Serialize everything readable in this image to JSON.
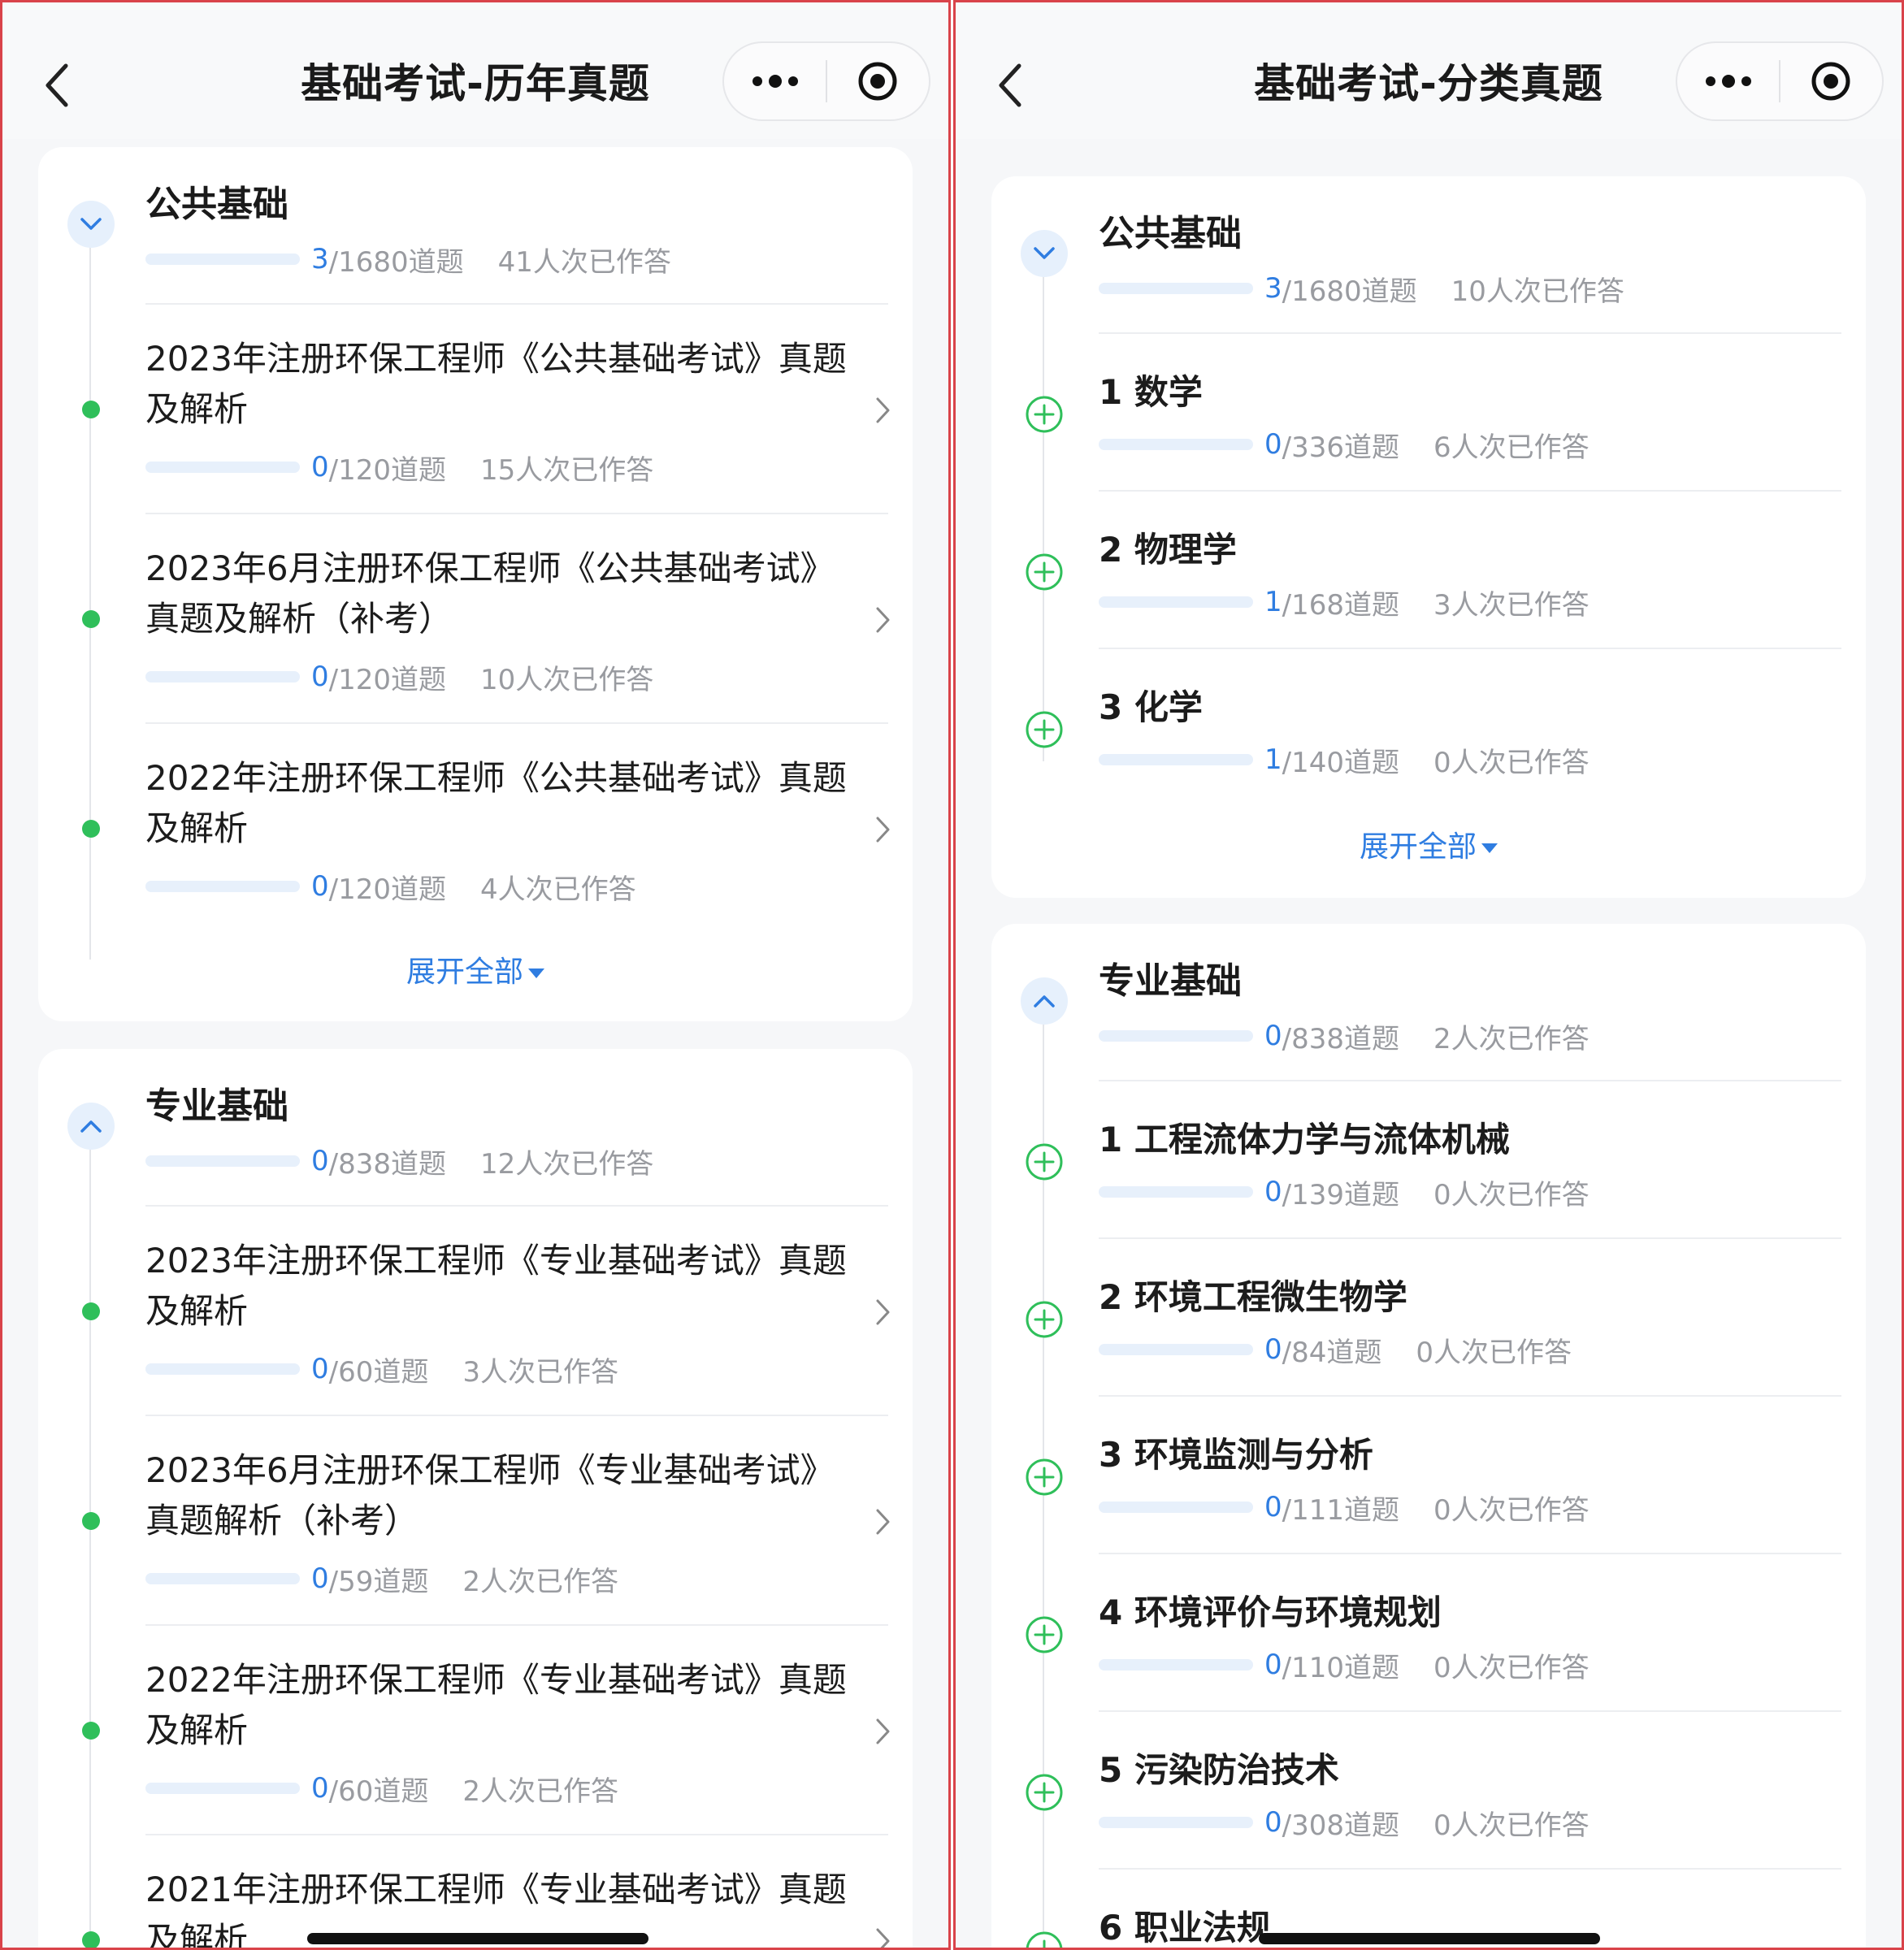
{
  "left": {
    "title": "基础考试-历年真题",
    "groups": [
      {
        "title": "公共基础",
        "done": "3",
        "total": "/1680道题",
        "answered": "41人次已作答",
        "items": [
          {
            "line1": "2023年注册环保工程师《公共基础考试》真题",
            "line2": "及解析",
            "done": "0",
            "total": "/120道题",
            "answered": "15人次已作答"
          },
          {
            "line1": "2023年6月注册环保工程师《公共基础考试》",
            "line2": "真题及解析（补考）",
            "done": "0",
            "total": "/120道题",
            "answered": "10人次已作答"
          },
          {
            "line1": "2022年注册环保工程师《公共基础考试》真题",
            "line2": "及解析",
            "done": "0",
            "total": "/120道题",
            "answered": "4人次已作答"
          }
        ],
        "expand_label": "展开全部"
      },
      {
        "title": "专业基础",
        "done": "0",
        "total": "/838道题",
        "answered": "12人次已作答",
        "items": [
          {
            "line1": "2023年注册环保工程师《专业基础考试》真题",
            "line2": "及解析",
            "done": "0",
            "total": "/60道题",
            "answered": "3人次已作答"
          },
          {
            "line1": "2023年6月注册环保工程师《专业基础考试》",
            "line2": "真题解析（补考）",
            "done": "0",
            "total": "/59道题",
            "answered": "2人次已作答"
          },
          {
            "line1": "2022年注册环保工程师《专业基础考试》真题",
            "line2": "及解析",
            "done": "0",
            "total": "/60道题",
            "answered": "2人次已作答"
          },
          {
            "line1": "2021年注册环保工程师《专业基础考试》真题",
            "line2": "及解析"
          }
        ]
      }
    ]
  },
  "right": {
    "title": "基础考试-分类真题",
    "groups": [
      {
        "title": "公共基础",
        "done": "3",
        "total": "/1680道题",
        "answered": "10人次已作答",
        "items": [
          {
            "title": "1 数学",
            "done": "0",
            "total": "/336道题",
            "answered": "6人次已作答"
          },
          {
            "title": "2 物理学",
            "done": "1",
            "total": "/168道题",
            "answered": "3人次已作答"
          },
          {
            "title": "3 化学",
            "done": "1",
            "total": "/140道题",
            "answered": "0人次已作答"
          }
        ],
        "expand_label": "展开全部"
      },
      {
        "title": "专业基础",
        "done": "0",
        "total": "/838道题",
        "answered": "2人次已作答",
        "items": [
          {
            "title": "1 工程流体力学与流体机械",
            "done": "0",
            "total": "/139道题",
            "answered": "0人次已作答"
          },
          {
            "title": "2 环境工程微生物学",
            "done": "0",
            "total": "/84道题",
            "answered": "0人次已作答"
          },
          {
            "title": "3 环境监测与分析",
            "done": "0",
            "total": "/111道题",
            "answered": "0人次已作答"
          },
          {
            "title": "4 环境评价与环境规划",
            "done": "0",
            "total": "/110道题",
            "answered": "0人次已作答"
          },
          {
            "title": "5 污染防治技术",
            "done": "0",
            "total": "/308道题",
            "answered": "0人次已作答"
          },
          {
            "title": "6 职业法规"
          }
        ]
      }
    ]
  },
  "colors": {
    "accent": "#2f7de1",
    "green": "#2fbf5a",
    "muted": "#999ba0",
    "frame": "#d9434a"
  },
  "icons": [
    "back-arrow-icon",
    "more-dots-icon",
    "target-icon",
    "chevron-down-icon",
    "chevron-up-icon",
    "chevron-right-icon",
    "plus-circle-icon",
    "triangle-down-icon"
  ]
}
